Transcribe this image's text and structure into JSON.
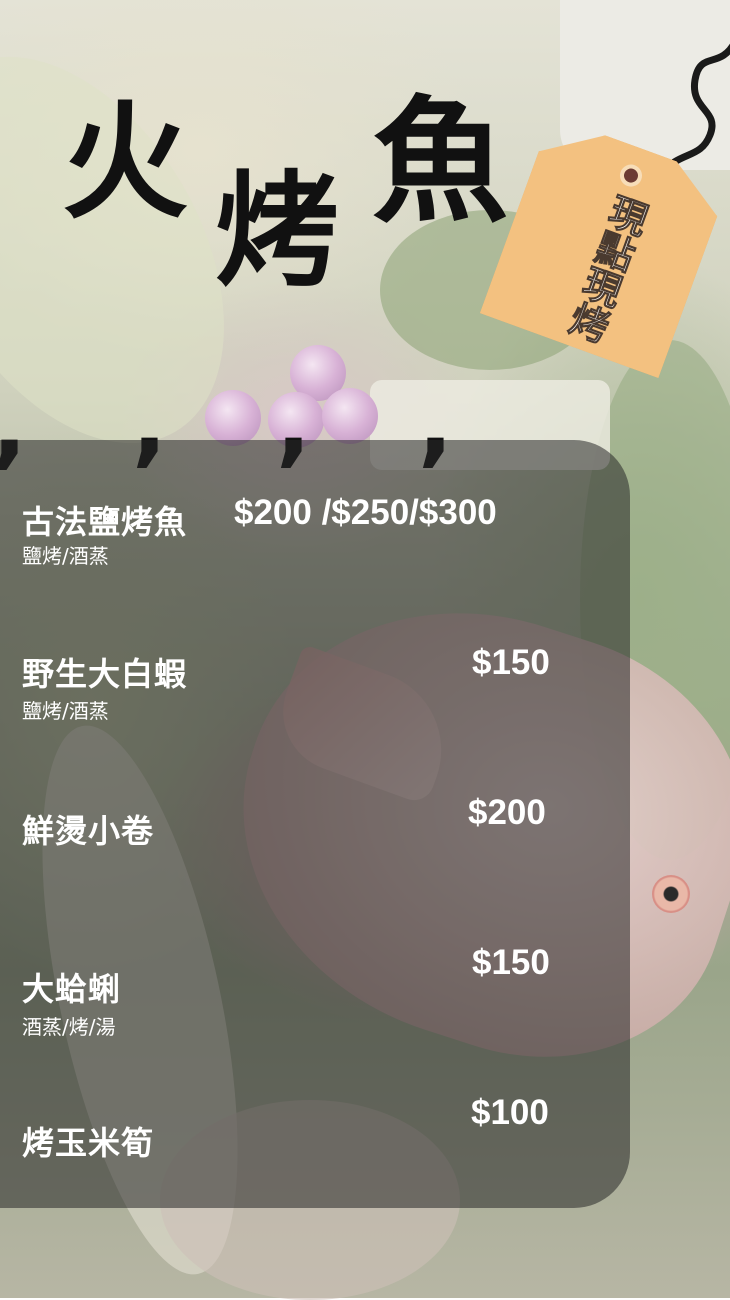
{
  "title": {
    "char1": "火",
    "char2": "烤",
    "char3": "魚"
  },
  "tag": {
    "text": "現點現烤"
  },
  "decor": {
    "commas": [
      ",",
      ",",
      ",",
      ","
    ]
  },
  "menu": {
    "items": [
      {
        "name": "古法鹽烤魚",
        "sub": "鹽烤/酒蒸",
        "price": "$200 /$250/$300"
      },
      {
        "name": "野生大白蝦",
        "sub": "鹽烤/酒蒸",
        "price": "$150"
      },
      {
        "name": "鮮燙小卷",
        "sub": "",
        "price": "$200"
      },
      {
        "name": "大蛤蜊",
        "sub": "酒蒸/烤/湯",
        "price": "$150"
      },
      {
        "name": "烤玉米筍",
        "sub": "",
        "price": "$100"
      }
    ]
  },
  "colors": {
    "title": "#111111",
    "tag": "#f3c180",
    "panel": "rgba(40,40,40,0.55)",
    "menu_text": "#ffffff"
  }
}
